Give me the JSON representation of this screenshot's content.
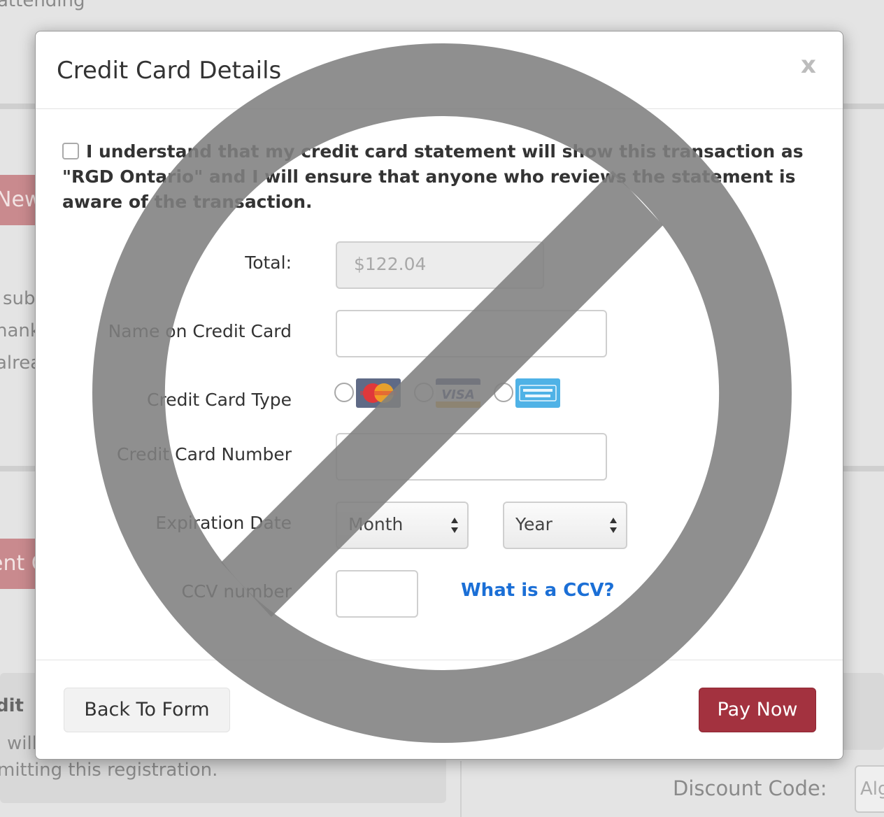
{
  "background": {
    "top_text": "attending",
    "new_button": "New",
    "lines": [
      "sub",
      "hank",
      "alrea"
    ],
    "event_button": "ent C",
    "credit_heading": "dit",
    "will_text": "will",
    "submit_text": "mitting this registration.",
    "discount_label": "Discount Code:",
    "discount_placeholder": "Alg"
  },
  "modal": {
    "title": "Credit Card Details",
    "close": "x",
    "agreement": "I understand that my credit card statement will show this transaction as \"RGD Ontario\" and I will ensure that anyone who reviews the statement is aware of the transaction.",
    "total_label": "Total:",
    "total_value": "$122.04",
    "name_label": "Name on Credit Card",
    "type_label": "Credit Card Type",
    "card_types": [
      "MasterCard",
      "VISA",
      "American Express"
    ],
    "number_label": "Credit Card Number",
    "expiry_label": "Expiration Date",
    "month_selected": "Month",
    "year_selected": "Year",
    "ccv_label": "CCV number",
    "ccv_help": "What is a CCV?",
    "back_button": "Back To Form",
    "pay_button": "Pay Now"
  },
  "colors": {
    "pay_button": "#a3323f",
    "link": "#1b6fd6",
    "prohibition_sign": "#7f7f7f"
  },
  "icons": [
    "close-icon",
    "mastercard-logo-icon",
    "visa-logo-icon",
    "amex-logo-icon",
    "select-arrows-icon",
    "prohibition-sign-icon"
  ]
}
